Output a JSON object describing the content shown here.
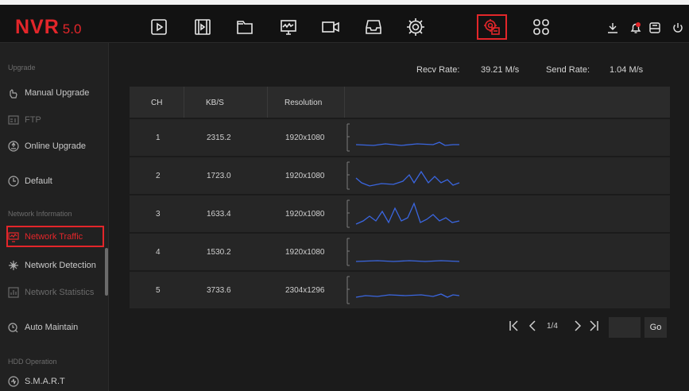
{
  "app": {
    "brand": "NVR",
    "version": "5.0"
  },
  "nav": {
    "icons": [
      "playback-icon",
      "video-files-icon",
      "folder-icon",
      "monitor-icon",
      "camera-icon",
      "storage-icon",
      "settings-icon",
      "system-maintenance-icon",
      "apps-icon"
    ],
    "active_index": 7
  },
  "tools": [
    "download-icon",
    "alarm-bell-icon",
    "backup-icon",
    "power-icon"
  ],
  "sidebar": {
    "sections": [
      {
        "heading": "Upgrade"
      },
      {
        "heading": "Network Information"
      },
      {
        "heading": "HDD Operation"
      }
    ],
    "items": [
      {
        "label": "Manual Upgrade",
        "icon": "hand-upgrade-icon",
        "dim": false
      },
      {
        "label": "FTP",
        "icon": "ftp-icon",
        "dim": true
      },
      {
        "label": "Online Upgrade",
        "icon": "online-upgrade-icon",
        "dim": false
      },
      {
        "label": "Default",
        "icon": "default-icon",
        "dim": false
      },
      {
        "label": "Network Traffic",
        "icon": "network-traffic-icon",
        "dim": false,
        "active": true
      },
      {
        "label": "Network Detection",
        "icon": "network-detection-icon",
        "dim": false
      },
      {
        "label": "Network Statistics",
        "icon": "network-statistics-icon",
        "dim": true
      },
      {
        "label": "Auto Maintain",
        "icon": "auto-maintain-icon",
        "dim": false
      },
      {
        "label": "S.M.A.R.T",
        "icon": "smart-icon",
        "dim": false
      }
    ]
  },
  "rates": {
    "recv_label": "Recv Rate:",
    "recv_value": "39.21 M/s",
    "send_label": "Send Rate:",
    "send_value": "1.04 M/s"
  },
  "table": {
    "headers": [
      "CH",
      "KB/S",
      "Resolution"
    ],
    "rows": [
      {
        "ch": "1",
        "kbs": "2315.2",
        "res": "1920x1080"
      },
      {
        "ch": "2",
        "kbs": "1723.0",
        "res": "1920x1080"
      },
      {
        "ch": "3",
        "kbs": "1633.4",
        "res": "1920x1080"
      },
      {
        "ch": "4",
        "kbs": "1530.2",
        "res": "1920x1080"
      },
      {
        "ch": "5",
        "kbs": "3733.6",
        "res": "2304x1296"
      }
    ]
  },
  "pager": {
    "first": "|<",
    "prev": "<",
    "page": "1/4",
    "next": ">",
    "last": ">|",
    "go": "Go"
  },
  "colors": {
    "accent": "#e3262a",
    "line": "#3a66e0",
    "background": "#1b1b1b"
  }
}
